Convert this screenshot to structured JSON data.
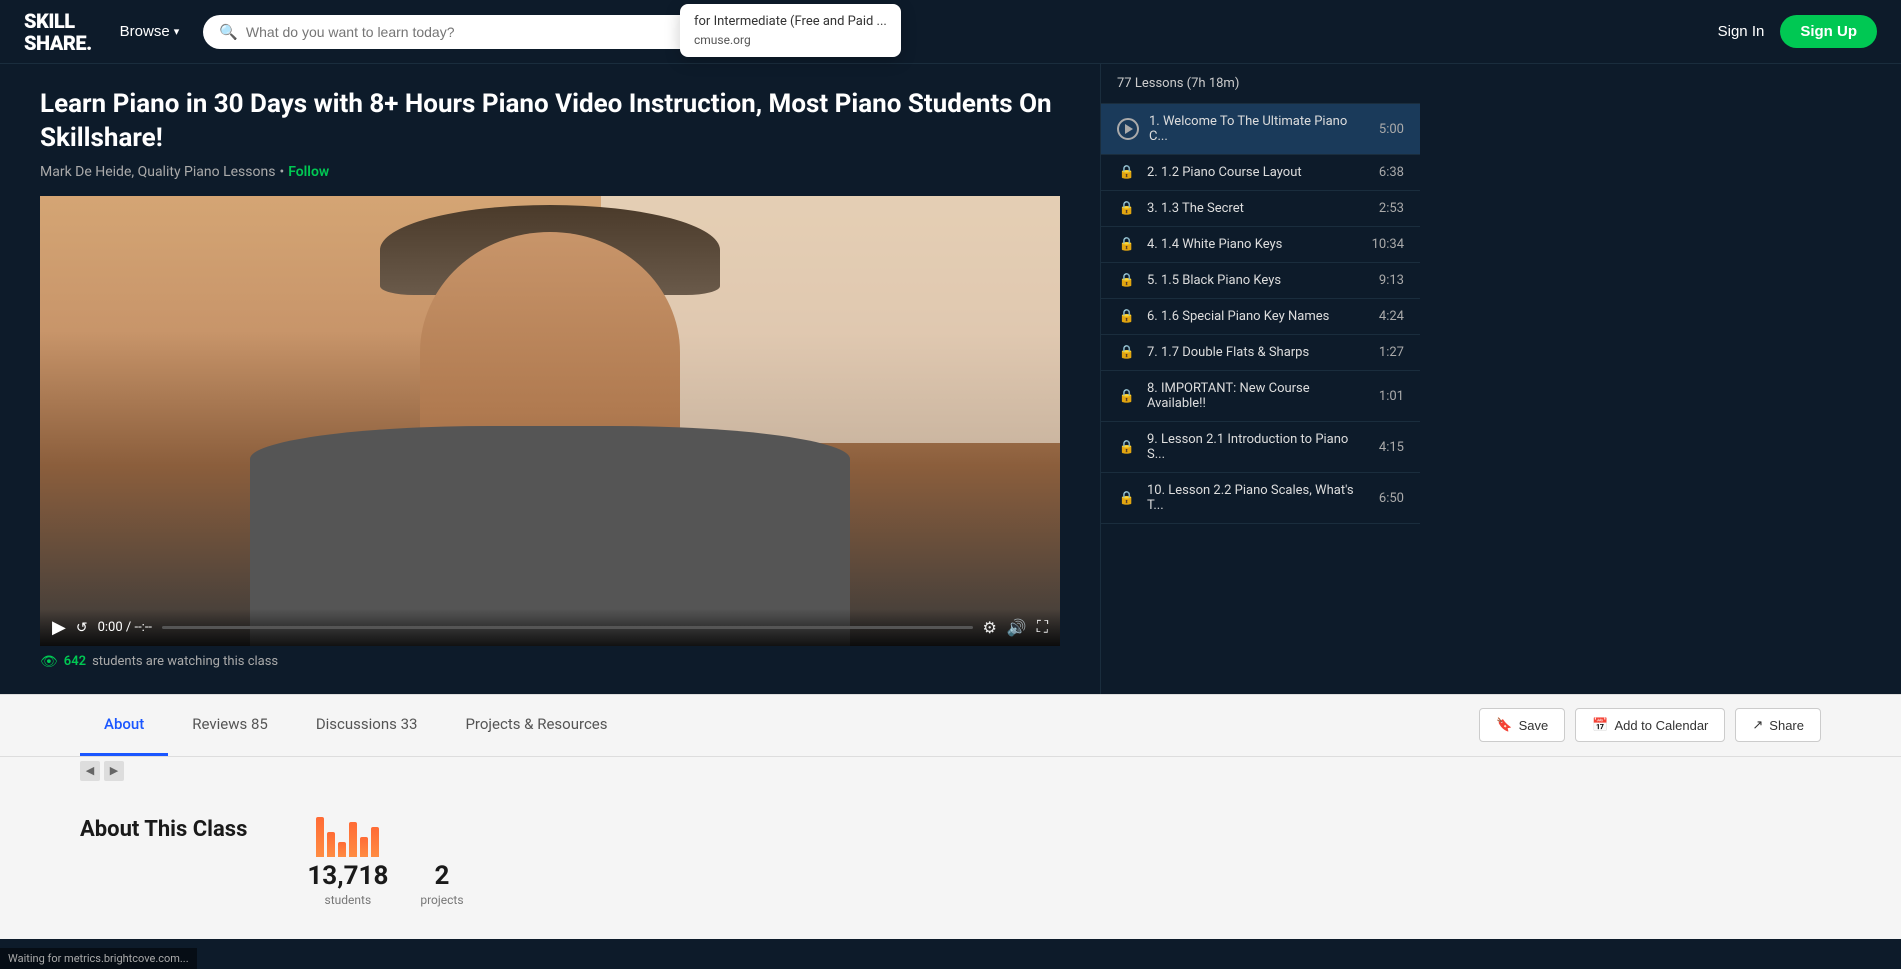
{
  "header": {
    "logo_line1": "SKILL",
    "logo_line2": "SHARE.",
    "logo_dot": ".",
    "browse_label": "Browse",
    "search_placeholder": "What do you want to learn today?",
    "sign_in_label": "Sign In",
    "sign_up_label": "Sign Up"
  },
  "tooltip": {
    "title": "for Intermediate (Free and Paid ...",
    "url": "cmuse.org"
  },
  "course": {
    "title": "Learn Piano in 30 Days with 8+ Hours Piano Video Instruction, Most Piano Students On Skillshare!",
    "author": "Mark De Heide, Quality Piano Lessons",
    "author_separator": "•",
    "follow_label": "Follow",
    "watching_prefix": "students are watching this class",
    "watching_count": "642",
    "eye_icon": "👁"
  },
  "video": {
    "time_current": "0:00",
    "time_separator": "/",
    "time_total": "--:--"
  },
  "lesson_sidebar": {
    "count_label": "77 Lessons (7h 18m)",
    "lessons": [
      {
        "number": "1.",
        "title": "Welcome To The Ultimate Piano C...",
        "duration": "5:00",
        "locked": false,
        "active": true
      },
      {
        "number": "2.",
        "title": "1.2 Piano Course Layout",
        "duration": "6:38",
        "locked": true,
        "active": false
      },
      {
        "number": "3.",
        "title": "1.3 The Secret",
        "duration": "2:53",
        "locked": true,
        "active": false
      },
      {
        "number": "4.",
        "title": "1.4 White Piano Keys",
        "duration": "10:34",
        "locked": true,
        "active": false
      },
      {
        "number": "5.",
        "title": "1.5 Black Piano Keys",
        "duration": "9:13",
        "locked": true,
        "active": false
      },
      {
        "number": "6.",
        "title": "1.6 Special Piano Key Names",
        "duration": "4:24",
        "locked": true,
        "active": false
      },
      {
        "number": "7.",
        "title": "1.7 Double Flats & Sharps",
        "duration": "1:27",
        "locked": true,
        "active": false
      },
      {
        "number": "8.",
        "title": "IMPORTANT: New Course Available!!",
        "duration": "1:01",
        "locked": true,
        "active": false
      },
      {
        "number": "9.",
        "title": "Lesson 2.1 Introduction to Piano S...",
        "duration": "4:15",
        "locked": true,
        "active": false
      },
      {
        "number": "10.",
        "title": "Lesson 2.2 Piano Scales, What's T...",
        "duration": "6:50",
        "locked": true,
        "active": false
      }
    ]
  },
  "tabs": {
    "items": [
      {
        "label": "About",
        "active": true
      },
      {
        "label": "Reviews",
        "count": "85",
        "active": false
      },
      {
        "label": "Discussions",
        "count": "33",
        "active": false
      },
      {
        "label": "Projects & Resources",
        "active": false
      }
    ],
    "save_label": "Save",
    "add_to_calendar_label": "Add to Calendar",
    "share_label": "Share"
  },
  "about": {
    "title": "About This Class",
    "stat1_number": "13,718",
    "stat1_label": "students",
    "stat2_number": "2",
    "stat2_label": "projects",
    "bars": [
      40,
      25,
      15,
      35,
      20,
      30
    ]
  },
  "footer": {
    "status": "Waiting for metrics.brightcove.com..."
  }
}
